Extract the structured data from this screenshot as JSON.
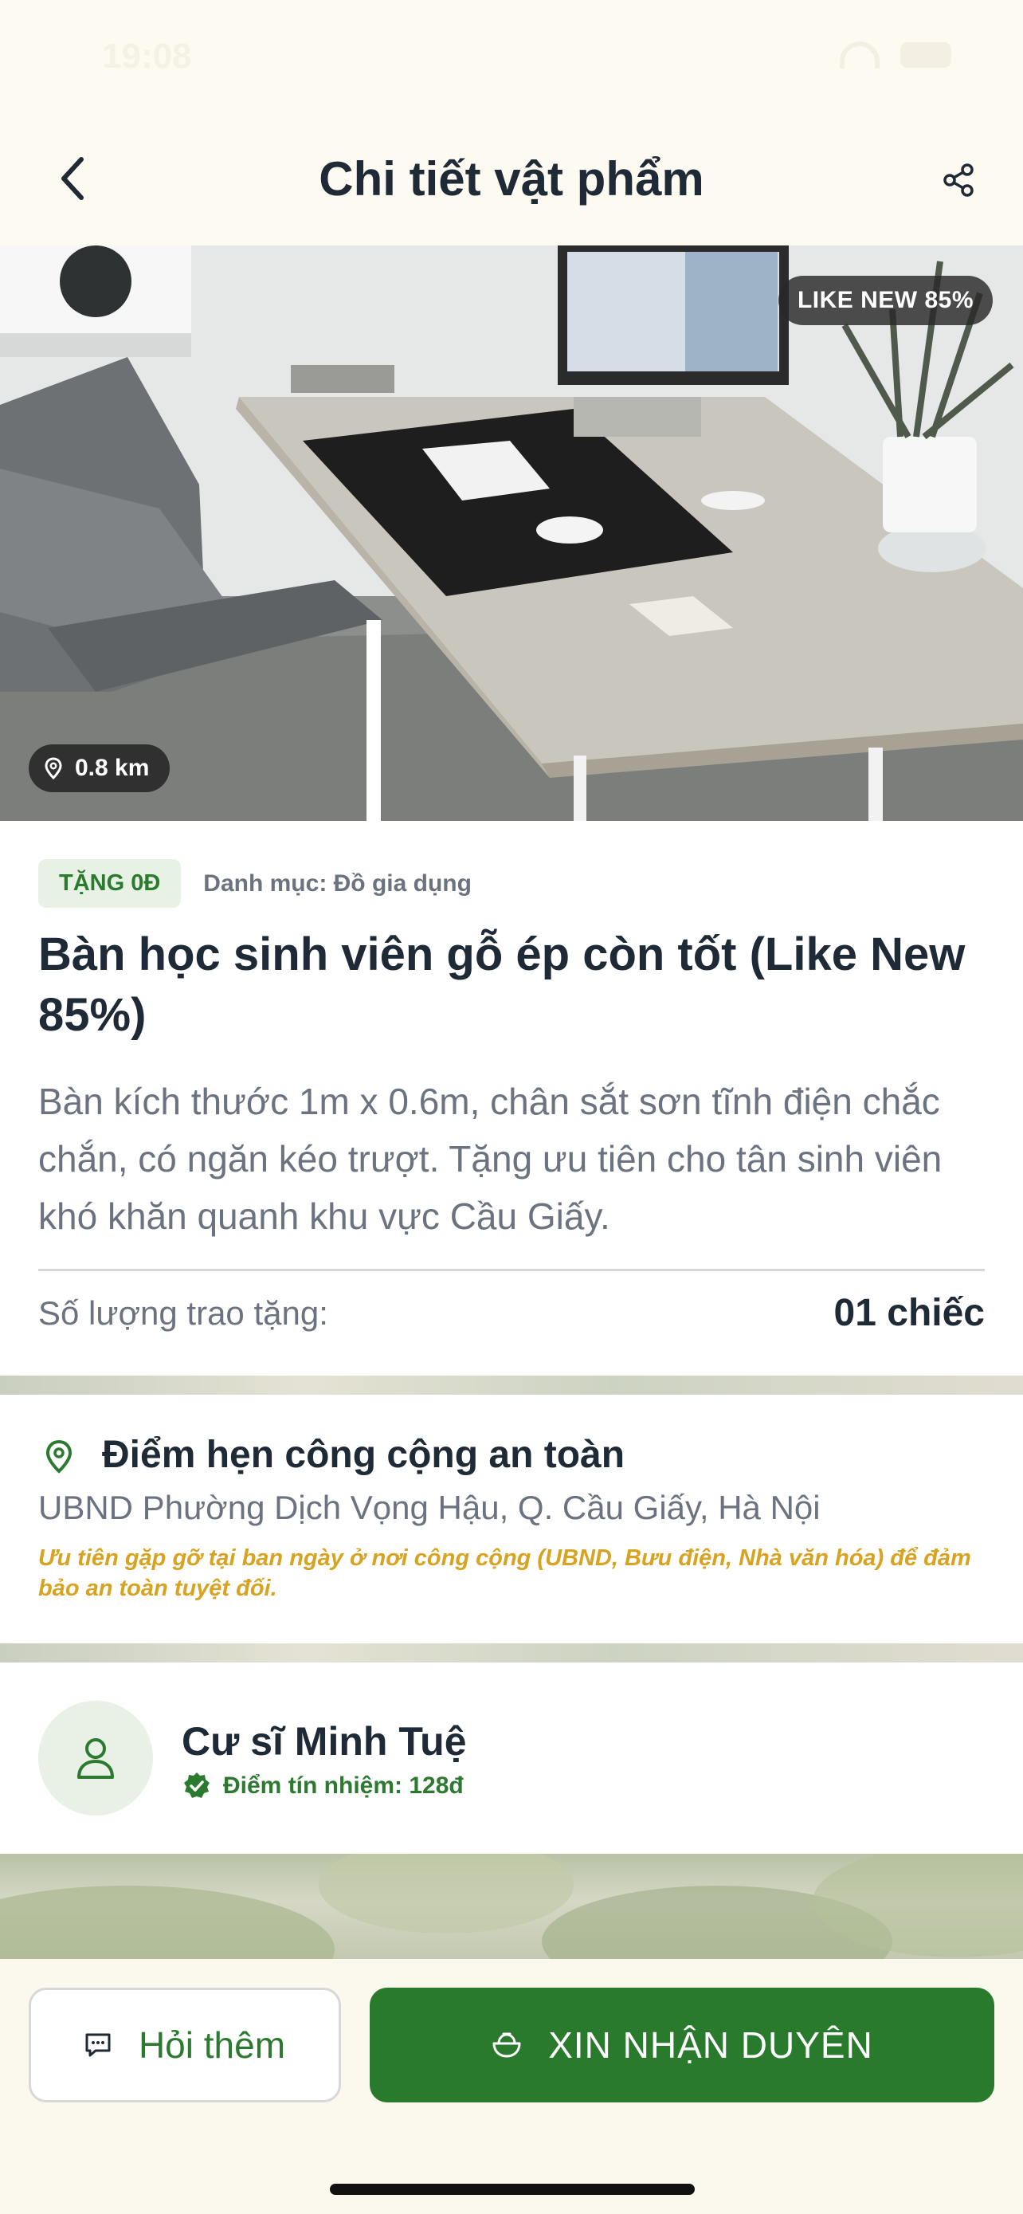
{
  "status_bar": {
    "time": "19:08"
  },
  "header": {
    "title": "Chi tiết vật phẩm",
    "back_icon": "chevron-left-icon",
    "share_icon": "share-icon"
  },
  "hero": {
    "condition_badge": "LIKE NEW 85%",
    "distance": "0.8 km"
  },
  "item": {
    "tag": "TẶNG 0Đ",
    "category": "Danh mục: Đồ gia dụng",
    "title": "Bàn học sinh viên gỗ ép còn tốt (Like New 85%)",
    "description": "Bàn kích thước 1m x 0.6m, chân sắt sơn tĩnh điện chắc chắn, có ngăn kéo trượt. Tặng ưu tiên cho tân sinh viên khó khăn quanh khu vực Cầu Giấy.",
    "quantity_label": "Số lượng trao tặng:",
    "quantity_value": "01 chiếc"
  },
  "meeting": {
    "title": "Điểm hẹn công cộng an toàn",
    "address": "UBND Phường Dịch Vọng Hậu, Q. Cầu Giấy, Hà Nội",
    "note": "Ưu tiên gặp gỡ tại ban ngày ở nơi công cộng (UBND, Bưu điện, Nhà văn hóa) để đảm bảo an toàn tuyệt đối."
  },
  "user": {
    "name": "Cư sĩ Minh Tuệ",
    "score": "Điểm tín nhiệm: 128đ"
  },
  "actions": {
    "ask_label": "Hỏi thêm",
    "receive_label": "XIN NHẬN DUYÊN"
  },
  "colors": {
    "primary_green": "#2a7a2e",
    "accent_gold": "#d7a321",
    "background": "#fbf8ee"
  }
}
